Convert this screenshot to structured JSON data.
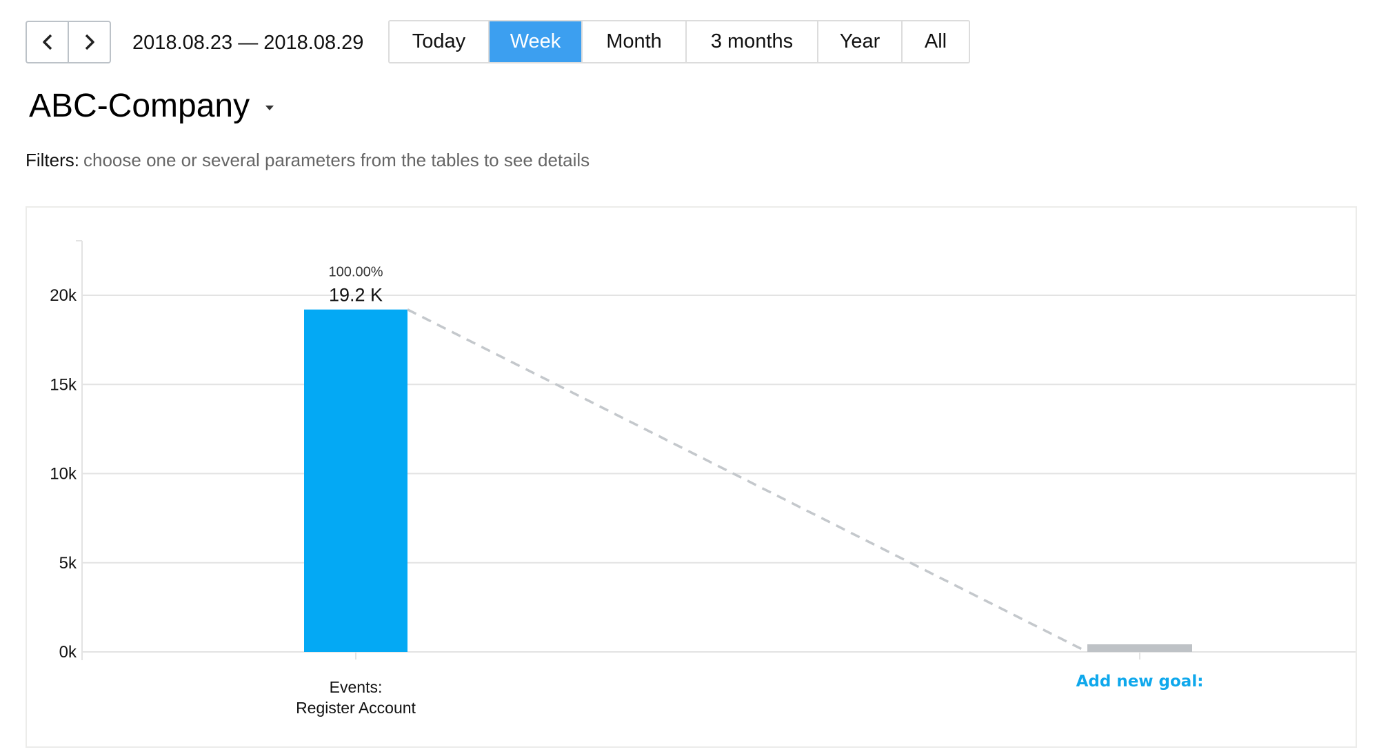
{
  "navigation": {
    "prev_icon": "chevron-left-icon",
    "next_icon": "chevron-right-icon",
    "date_range": "2018.08.23 — 2018.08.29"
  },
  "period_tabs": [
    {
      "label": "Today",
      "active": false
    },
    {
      "label": "Week",
      "active": true
    },
    {
      "label": "Month",
      "active": false
    },
    {
      "label": "3 months",
      "active": false
    },
    {
      "label": "Year",
      "active": false
    },
    {
      "label": "All",
      "active": false
    }
  ],
  "company": {
    "name": "ABC-Company",
    "dropdown_icon": "caret-down-icon"
  },
  "filters": {
    "label": "Filters:",
    "hint": "choose one or several parameters from the tables to see details"
  },
  "colors": {
    "accent": "#3c9ff0",
    "bar": "#04a9f4",
    "goal_bar": "#bec2c6",
    "goal_link": "#0fa8ec",
    "dashed_line": "#c4c8cc",
    "grid": "#e3e3e3"
  },
  "chart_data": {
    "type": "bar",
    "title": "",
    "xlabel": "",
    "ylabel": "",
    "ylim": [
      0,
      23000
    ],
    "yticks": [
      0,
      5000,
      10000,
      15000,
      20000
    ],
    "ytick_labels": [
      "0k",
      "5k",
      "10k",
      "15k",
      "20k"
    ],
    "grid": true,
    "categories": [
      {
        "lines": [
          "Events:",
          "Register Account"
        ],
        "kind": "step"
      },
      {
        "lines": [
          "Add new goal:"
        ],
        "kind": "add-goal"
      }
    ],
    "values": [
      19200,
      0
    ],
    "value_labels": [
      "19.2 K",
      ""
    ],
    "percent_labels": [
      "100.00%",
      ""
    ],
    "connector": "dashed"
  }
}
